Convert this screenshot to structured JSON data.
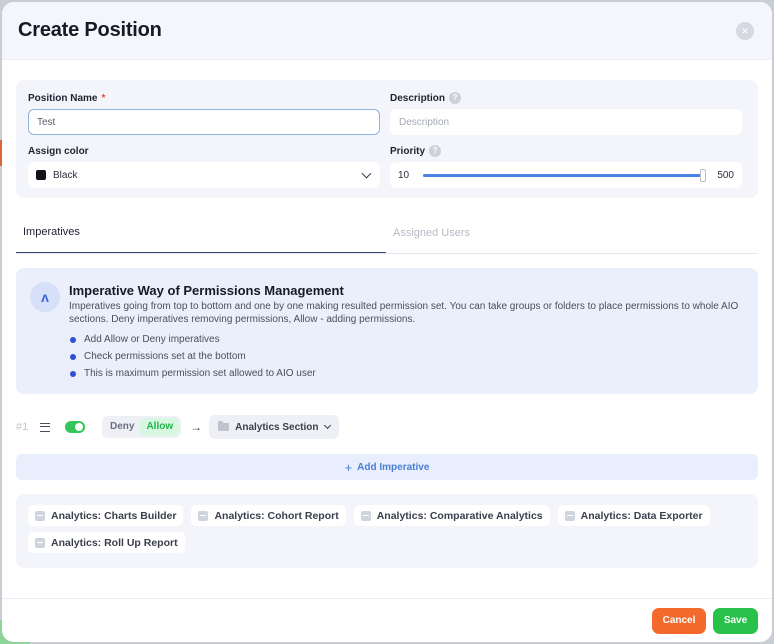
{
  "modal": {
    "title": "Create Position",
    "close_glyph": "×"
  },
  "form": {
    "position_name": {
      "label": "Position Name",
      "required_mark": "*",
      "value": "Test"
    },
    "description": {
      "label": "Description",
      "placeholder": "Description",
      "value": ""
    },
    "assign_color": {
      "label": "Assign color",
      "selected": "Black",
      "swatch_color": "#111318"
    },
    "priority": {
      "label": "Priority",
      "min_label": "10",
      "max_label": "500",
      "value": 500,
      "min": 10,
      "max": 500
    }
  },
  "tabs": [
    {
      "label": "Imperatives",
      "active": true
    },
    {
      "label": "Assigned Users",
      "active": false
    }
  ],
  "info": {
    "icon_glyph": "ʌ",
    "title": "Imperative Way of Permissions Management",
    "text": "Imperatives going from top to bottom and one by one making resulted permission set. You can take groups or folders to place permissions to whole AIO sections. Deny imperatives removing permissions, Allow - adding permissions.",
    "bullets": [
      "Add Allow or Deny imperatives",
      "Check permissions set at the bottom",
      "This is maximum permission set allowed to AIO user"
    ]
  },
  "imperative": {
    "number": "#1",
    "enabled": true,
    "deny_label": "Deny",
    "allow_label": "Allow",
    "selected_mode": "Allow",
    "arrow_glyph": "→",
    "section": "Analytics Section"
  },
  "add_imperative": {
    "plus": "+",
    "label": "Add Imperative"
  },
  "permissions": [
    "Analytics: Charts Builder",
    "Analytics: Cohort Report",
    "Analytics: Comparative Analytics",
    "Analytics: Data Exporter",
    "Analytics: Roll Up Report"
  ],
  "footer": {
    "cancel_label": "Cancel",
    "save_label": "Save"
  },
  "colors": {
    "accent_blue": "#4a86e8",
    "toggle_green": "#34c659",
    "cancel_orange": "#f4692c",
    "save_green": "#28c24a"
  }
}
